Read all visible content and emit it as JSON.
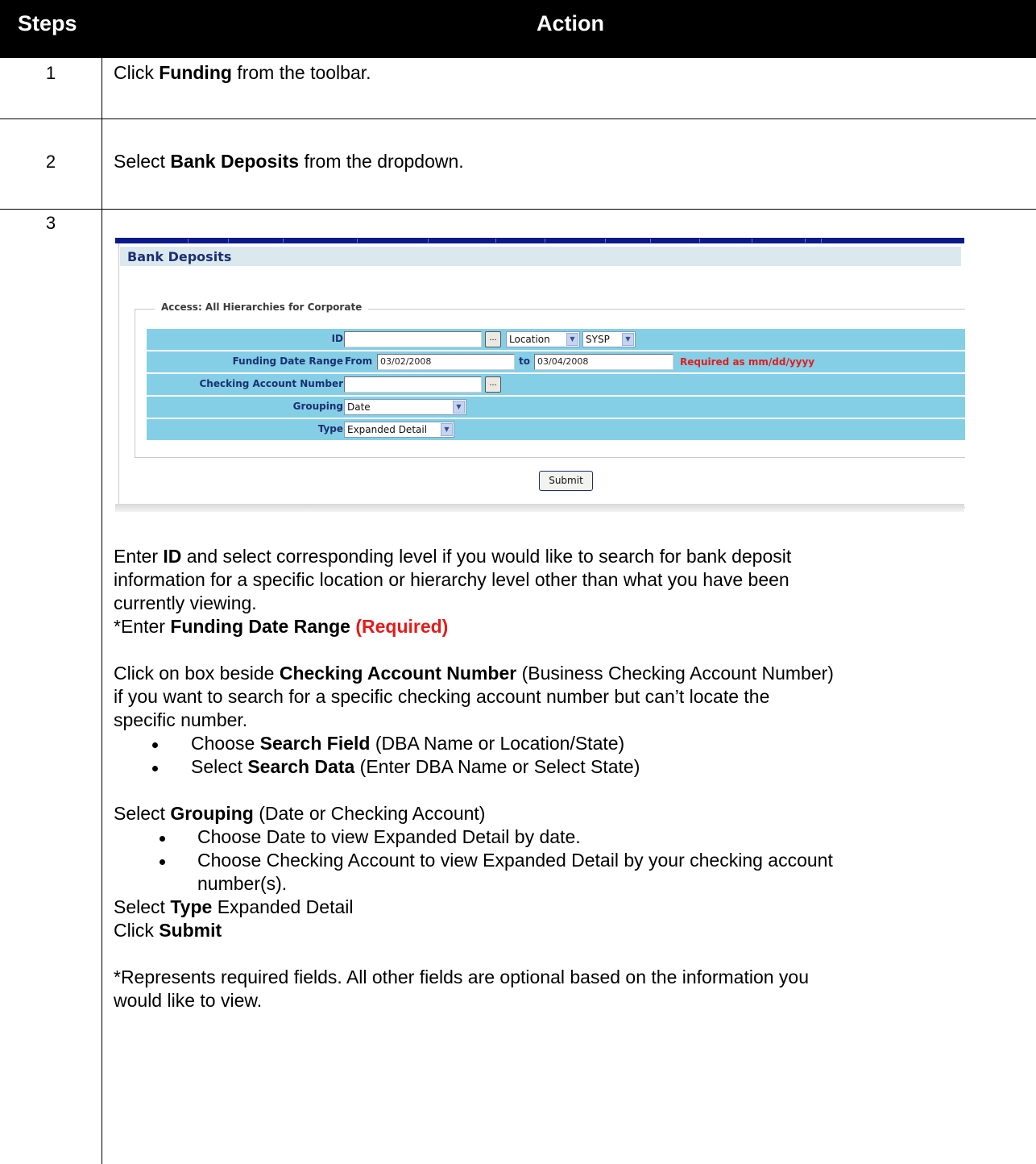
{
  "header": {
    "steps": "Steps",
    "action": "Action"
  },
  "rows": [
    {
      "step": "1",
      "pre": "Click ",
      "bold": "Funding",
      "post": " from the toolbar."
    },
    {
      "step": "2",
      "pre": "Select ",
      "bold": "Bank Deposits",
      "post": " from the dropdown."
    },
    {
      "step": "3"
    }
  ],
  "shot": {
    "title": "Bank Deposits",
    "legend": "Access: All Hierarchies for Corporate",
    "id_label": "ID",
    "id_value": "",
    "level_select": "Location",
    "sysp_select": "SYSP",
    "date_range_label": "Funding Date Range",
    "from_label": "From",
    "from_value": "03/02/2008",
    "to_label": "to",
    "to_value": "03/04/2008",
    "required_note": "Required as mm/dd/yyyy",
    "checking_label": "Checking Account Number",
    "checking_value": "",
    "grouping_label": "Grouping",
    "grouping_value": "Date",
    "type_label": "Type",
    "type_value": "Expanded Detail",
    "lookup_glyph": "...",
    "submit": "Submit"
  },
  "step3": {
    "p1a": "Enter ",
    "p1b": "ID",
    "p1c": " and select corresponding level if you would like to search for bank deposit",
    "p1d": "information for a specific location or hierarchy level other than what you have been",
    "p1e": "currently viewing.",
    "p2a": "*Enter ",
    "p2b": "Funding Date Range ",
    "p2c": "(Required)",
    "p3a": "Click on box beside ",
    "p3b": "Checking Account Number",
    "p3c": " (Business Checking Account Number)",
    "p3d": "if you want to search for a specific checking account number but can’t locate the",
    "p3e": "specific number.",
    "b1a": "Choose ",
    "b1b": "Search Field",
    "b1c": " (DBA Name or Location/State)",
    "b2a": "Select ",
    "b2b": "Search Data",
    "b2c": " (Enter DBA Name or Select State)",
    "p4a": "Select ",
    "p4b": "Grouping",
    "p4c": " (Date or Checking Account)",
    "b3": "Choose Date to view Expanded Detail by date.",
    "b4a": "Choose Checking Account to view Expanded Detail by your checking account",
    "b4b": "number(s).",
    "p5a": "Select ",
    "p5b": "Type",
    "p5c": " Expanded Detail",
    "p6a": "Click ",
    "p6b": "Submit",
    "p7a": "*Represents required fields. All other fields are optional based on the information you",
    "p7b": "would like to view."
  }
}
